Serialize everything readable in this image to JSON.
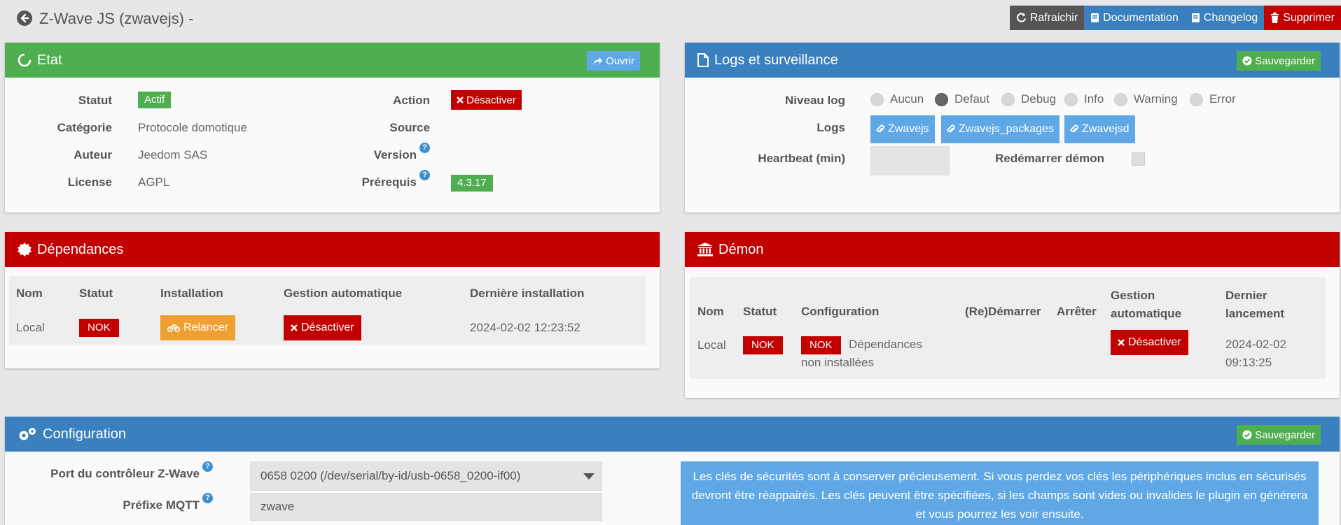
{
  "header": {
    "title": "Z-Wave JS (zwavejs) -",
    "actions": {
      "refresh": "Rafraichir",
      "documentation": "Documentation",
      "changelog": "Changelog",
      "delete": "Supprimer"
    }
  },
  "etat": {
    "title": "Etat",
    "open_label": "Ouvrir",
    "statut_label": "Statut",
    "statut_value": "Actif",
    "categorie_label": "Catégorie",
    "categorie_value": "Protocole domotique",
    "auteur_label": "Auteur",
    "auteur_value": "Jeedom SAS",
    "license_label": "License",
    "license_value": "AGPL",
    "action_label": "Action",
    "action_button": "Désactiver",
    "source_label": "Source",
    "version_label": "Version",
    "prerequis_label": "Prérequis",
    "prerequis_value": "4.3.17",
    "help_glyph": "?"
  },
  "logs": {
    "title": "Logs et surveillance",
    "save_label": "Sauvegarder",
    "niveau_label": "Niveau log",
    "levels": [
      "Aucun",
      "Defaut",
      "Debug",
      "Info",
      "Warning",
      "Error"
    ],
    "selected_level": "Defaut",
    "logs_label": "Logs",
    "log_files": [
      "Zwavejs",
      "Zwavejs_packages",
      "Zwavejsd"
    ],
    "heartbeat_label": "Heartbeat (min)",
    "restart_label": "Redémarrer démon"
  },
  "dependances": {
    "title": "Dépendances",
    "columns": [
      "Nom",
      "Statut",
      "Installation",
      "Gestion automatique",
      "Dernière installation"
    ],
    "row": {
      "nom": "Local",
      "statut": "NOK",
      "install_button": "Relancer",
      "auto_button": "Désactiver",
      "last_install": "2024-02-02 12:23:52"
    }
  },
  "demon": {
    "title": "Démon",
    "columns": [
      "Nom",
      "Statut",
      "Configuration",
      "(Re)Démarrer",
      "Arrêter",
      "Gestion automatique",
      "Dernier lancement"
    ],
    "row": {
      "nom": "Local",
      "statut": "NOK",
      "config_badge": "NOK",
      "config_text": "Dépendances non installées",
      "auto_button": "Désactiver",
      "last_launch": "2024-02-02 09:13:25"
    }
  },
  "configuration": {
    "title": "Configuration",
    "save_label": "Sauvegarder",
    "port_label": "Port du contrôleur Z-Wave",
    "port_value": "0658 0200 (/dev/serial/by-id/usb-0658_0200-if00)",
    "mqtt_label": "Préfixe MQTT",
    "mqtt_value": "zwave",
    "notice": "Les clés de sécurités sont à conserver précieusement. Si vous perdez vos clés les périphériques inclus en sécurisés devront être réappairés. Les clés peuvent être spécifiées, si les champs sont vides ou invalides le plugin en générera et vous pourrez les voir ensuite."
  },
  "colors": {
    "green": "#4fae4f",
    "blue": "#3a80bf",
    "red": "#c20000",
    "light_blue": "#5fa8e5",
    "orange": "#f0a030",
    "dark_gray": "#555555"
  }
}
